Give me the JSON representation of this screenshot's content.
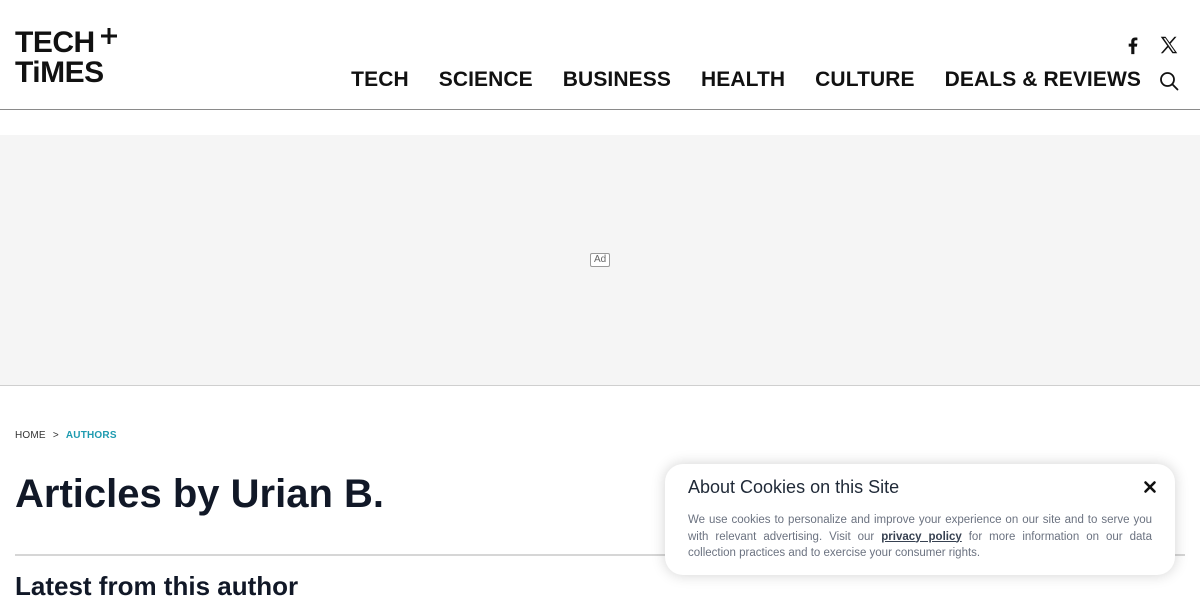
{
  "header": {
    "logo": {
      "line1": "TECH",
      "line2": "TiMES"
    },
    "nav": [
      "TECH",
      "SCIENCE",
      "BUSINESS",
      "HEALTH",
      "CULTURE",
      "DEALS & REVIEWS"
    ]
  },
  "ad": {
    "label": "Ad"
  },
  "breadcrumb": {
    "home": "HOME",
    "separator": ">",
    "current": "AUTHORS"
  },
  "main": {
    "title": "Articles by Urian B.",
    "section_title": "Latest from this author"
  },
  "cookie_banner": {
    "title": "About Cookies on this Site",
    "text_before": "We use cookies to personalize and improve your experience on our site and to serve you with relevant advertising. Visit our ",
    "link": "privacy policy",
    "text_after": " for more information on our data collection practices and to exercise your consumer rights."
  },
  "colors": {
    "accent": "#1e9bb0",
    "text": "#111827",
    "ad_background": "#f5f5f5"
  }
}
